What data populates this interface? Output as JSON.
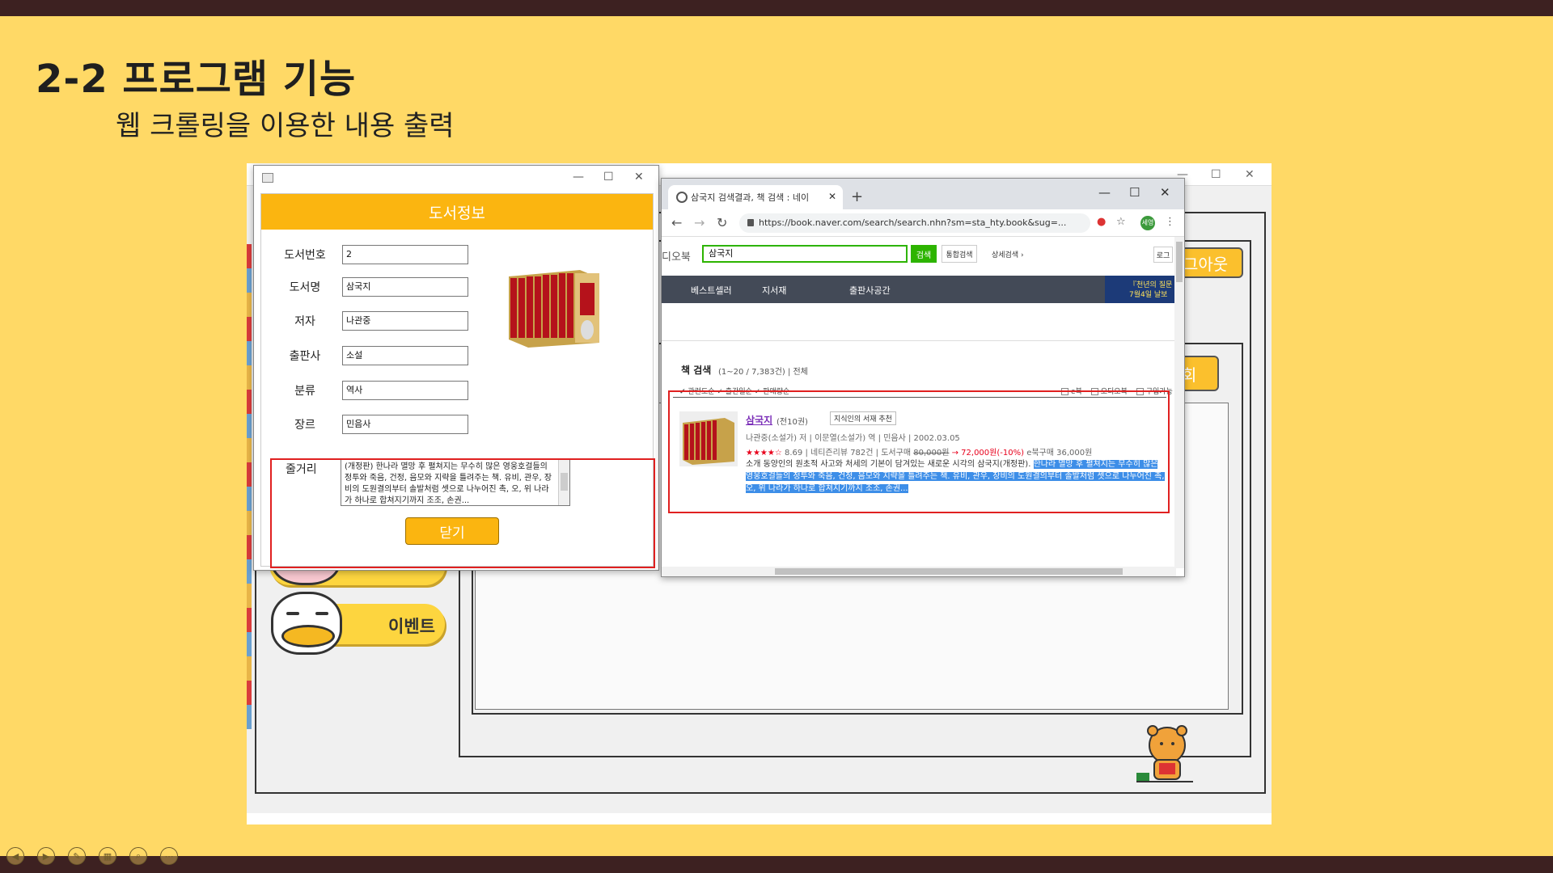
{
  "slide": {
    "title": "2-2 프로그램 기능",
    "subtitle": "웹 크롤링을 이용한 내용 출력"
  },
  "background_app": {
    "logout_label": "그아웃",
    "query_label": "회",
    "event_label": "이벤트",
    "menu_label": "이벤트"
  },
  "dialog": {
    "header": "도서정보",
    "fields": [
      {
        "label": "도서번호",
        "value": "2"
      },
      {
        "label": "도서명",
        "value": "삼국지"
      },
      {
        "label": "저자",
        "value": "나관중"
      },
      {
        "label": "출판사",
        "value": "소설"
      },
      {
        "label": "분류",
        "value": "역사"
      },
      {
        "label": "장르",
        "value": "민음사"
      }
    ],
    "summary_label": "줄거리",
    "summary_text": "(개정판) 한나라 멸망 후 펼쳐지는 무수히 많은 영웅호걸들의 정투와 죽음, 건정, 음모와 지략을 틀려주는 책. 유비, 관우, 장비의 도원결의부터 솔발처럼 셋으로 나누어진 촉, 오, 위 나라가 하나로 합쳐지기까지 조조, 손권...",
    "close_button": "닫기"
  },
  "browser": {
    "tab_title": "삼국지 검색결과, 책 검색 : 네이",
    "url": "https://book.naver.com/search/search.nhn?sm=sta_hty.book&sug=...",
    "profile": "세영",
    "site": {
      "brand": "디오북",
      "search_value": "삼국지",
      "search_button": "검색",
      "total_search": "통합검색",
      "detail_search": "상세검색 ›",
      "login": "로그",
      "menu": [
        "베스트셀러",
        "지서재",
        "출판사공간"
      ],
      "banner": "『천년의 질문 7월4일 날보"
    },
    "results": {
      "title": "책 검색",
      "count": "(1~20 / 7,383건) | 전체",
      "filters": "✔ 관련도순  ✓ 출간일순  ✓ 판매량순",
      "options": [
        "e북",
        "오디오북",
        "구입가능"
      ],
      "book": {
        "title": "삼국지",
        "volumes": "(전10권)",
        "badge": "지식인의 서재 추천",
        "meta": "나관중(소설가) 저 | 이문열(소설가) 역 | 민음사 | 2002.03.05",
        "stars": "★★★★☆",
        "rating": "8.69",
        "reviews": "| 네티즌리뷰 782건 |",
        "buy": "도서구매",
        "old_price": "80,000원",
        "sale_price": "→ 72,000원(-10%)",
        "ebook": "e북구매 36,000원",
        "desc_plain": "소개  동양인의 원초적 사고와 처세의 기본이 담겨있는 새로운 시각의 삼국지(개정판).",
        "desc_highlight": "한나라 멸망 후 펼쳐지는 무수히 많은 영웅호걸들의 정투와 죽음, 건정, 음모와 지략을 틀려주는 책. 유비, 관우, 장비의 도원결의부터 솔발처럼 셋으로 나누어진 촉, 오, 위 나라가 하나로 합쳐지기까지 조조, 손권..."
      }
    }
  }
}
